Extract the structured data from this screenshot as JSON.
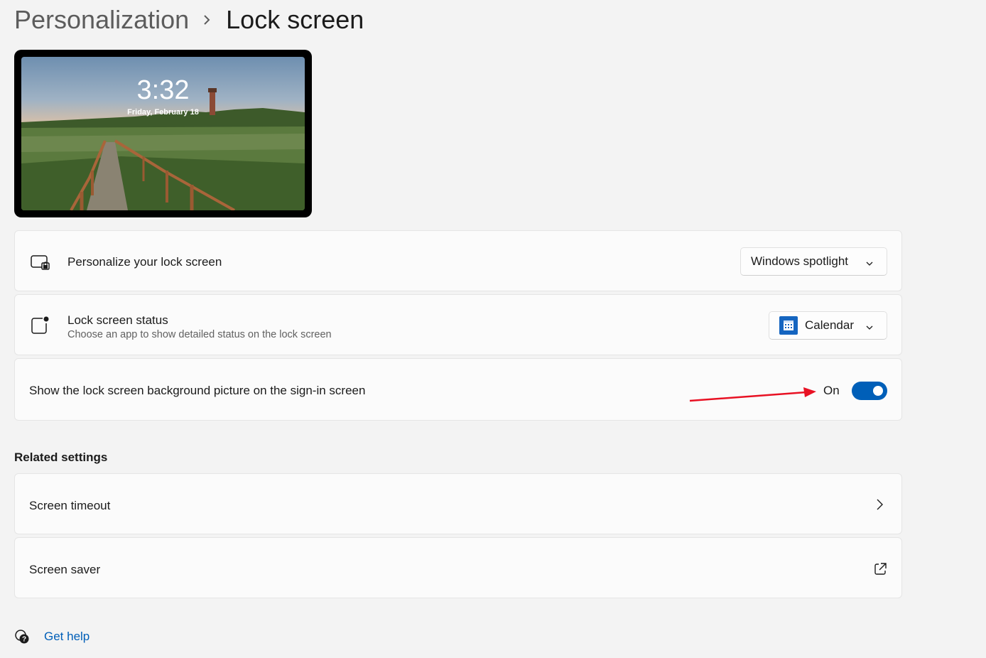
{
  "breadcrumb": {
    "parent": "Personalization",
    "separator": "›",
    "current": "Lock screen"
  },
  "preview": {
    "time": "3:32",
    "date": "Friday, February 18"
  },
  "settings": {
    "personalize": {
      "icon": "lock-screen-monitor-icon",
      "title": "Personalize your lock screen",
      "value": "Windows spotlight"
    },
    "status": {
      "icon": "lock-screen-status-icon",
      "title": "Lock screen status",
      "subtitle": "Choose an app to show detailed status on the lock screen",
      "value": "Calendar",
      "value_icon": "calendar-app-icon"
    },
    "signin_background": {
      "title": "Show the lock screen background picture on the sign-in screen",
      "state_label": "On",
      "enabled": true
    }
  },
  "related": {
    "title": "Related settings",
    "items": [
      {
        "label": "Screen timeout",
        "icon": "chevron-right-icon"
      },
      {
        "label": "Screen saver",
        "icon": "external-link-icon"
      }
    ]
  },
  "help": {
    "label": "Get help",
    "icon": "get-help-icon"
  },
  "colors": {
    "accent": "#005fb8",
    "annotation_arrow": "#e81123",
    "background": "#f3f3f3",
    "card": "#fbfbfb"
  }
}
